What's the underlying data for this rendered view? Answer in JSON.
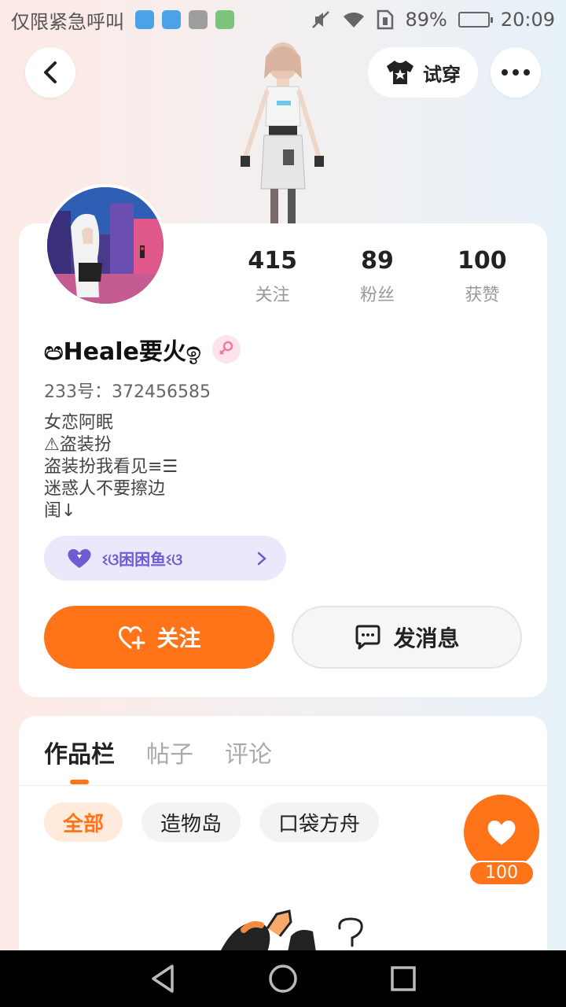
{
  "status_bar": {
    "carrier": "仅限紧急呼叫",
    "battery": "89%",
    "battery_level": 0.89,
    "time": "20:09"
  },
  "header": {
    "try_on_label": "试穿"
  },
  "profile": {
    "nickname": "ඏHeale要火ඉ",
    "id_label": "233号：",
    "id_value": "372456585",
    "bio_lines": [
      "女恋阿眠",
      "⚠盗装扮",
      "盗装扮我看见≡☰",
      "迷惑人不要擦边",
      "闺↓"
    ],
    "stats": [
      {
        "value": "415",
        "label": "关注"
      },
      {
        "value": "89",
        "label": "粉丝"
      },
      {
        "value": "100",
        "label": "获赞"
      }
    ],
    "fan_badge": "ଽଓ困困鱼ଽଓ",
    "follow_label": "关注",
    "message_label": "发消息"
  },
  "works": {
    "tabs": [
      "作品栏",
      "帖子",
      "评论"
    ],
    "active_tab": 0,
    "chips": [
      "全部",
      "造物岛",
      "口袋方舟"
    ],
    "active_chip": 0
  },
  "like_fab": {
    "count": "100"
  },
  "colors": {
    "accent": "#ff7419",
    "badge_bg": "#ebe8fb",
    "badge_text": "#6c5dd3"
  }
}
